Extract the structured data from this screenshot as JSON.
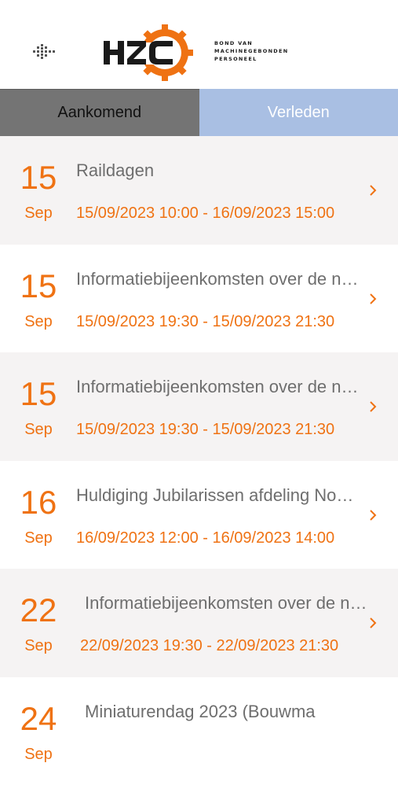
{
  "brand": {
    "logo_text": "HZC",
    "subtitle_lines": [
      "BOND VAN",
      "MACHINEGEBONDEN",
      "PERSONEEL"
    ],
    "orange": "#ef7213",
    "dark": "#1a1a1a"
  },
  "tabs": [
    {
      "label": "Aankomend",
      "selected": true
    },
    {
      "label": "Verleden",
      "selected": false
    }
  ],
  "events": [
    {
      "day": "15",
      "month": "Sep",
      "title": "Raildagen",
      "dates": "15/09/2023 10:00 - 16/09/2023 15:00"
    },
    {
      "day": "15",
      "month": "Sep",
      "title": "Informatiebijeenkomsten over de nieuwe cao",
      "dates": "15/09/2023 19:30 - 15/09/2023 21:30"
    },
    {
      "day": "15",
      "month": "Sep",
      "title": "Informatiebijeenkomsten over de nieuwe cao",
      "dates": "15/09/2023 19:30 - 15/09/2023 21:30"
    },
    {
      "day": "16",
      "month": "Sep",
      "title": "Huldiging Jubilarissen afdeling Noord",
      "dates": "16/09/2023 12:00 - 16/09/2023 14:00"
    },
    {
      "day": "22",
      "month": "Sep",
      "title": "Informatiebijeenkomsten over de nieuwe cao",
      "dates": "22/09/2023 19:30 - 22/09/2023 21:30"
    },
    {
      "day": "24",
      "month": "Sep",
      "title": "Miniaturendag 2023 (Bouwma",
      "dates": ""
    }
  ]
}
